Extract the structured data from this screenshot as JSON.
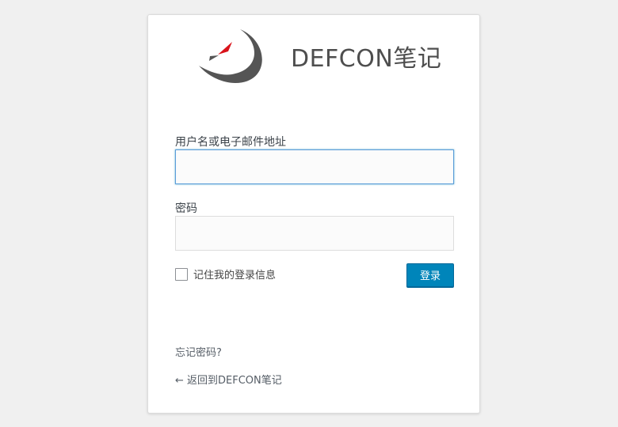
{
  "brand": {
    "site_name": "DEFCON笔记",
    "logo_icon": "defcon-logo-icon",
    "logo_colors": {
      "swoosh": "#555555",
      "accent": "#d9131b"
    }
  },
  "form": {
    "username_label": "用户名或电子邮件地址",
    "username_value": "",
    "password_label": "密码",
    "password_value": "",
    "remember_label": "记住我的登录信息",
    "remember_checked": false,
    "login_button_label": "登录"
  },
  "links": {
    "lost_password": "忘记密码?",
    "back_to_site": "← 返回到DEFCON笔记"
  },
  "colors": {
    "page_background": "#f0f0f0",
    "card_background": "#ffffff",
    "primary_button": "#0085ba",
    "focus_border": "#5b9dd9"
  }
}
